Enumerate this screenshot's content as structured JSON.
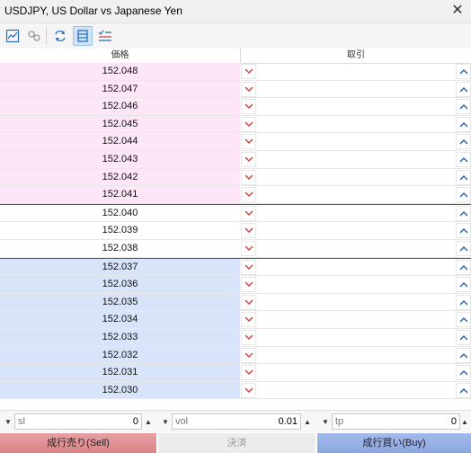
{
  "window": {
    "title": "USDJPY, US Dollar vs Japanese Yen"
  },
  "header": {
    "price_col": "価格",
    "trade_col": "取引"
  },
  "rows": {
    "ask": [
      "152.048",
      "152.047",
      "152.046",
      "152.045",
      "152.044",
      "152.043",
      "152.042",
      "152.041"
    ],
    "mid": [
      "152.040",
      "152.039",
      "152.038"
    ],
    "bid": [
      "152.037",
      "152.036",
      "152.035",
      "152.034",
      "152.033",
      "152.032",
      "152.031",
      "152.030"
    ]
  },
  "inputs": {
    "sl": {
      "placeholder": "sl",
      "value": "0"
    },
    "vol": {
      "placeholder": "vol",
      "value": "0.01"
    },
    "tp": {
      "placeholder": "tp",
      "value": "0"
    }
  },
  "actions": {
    "sell": "成行売り(Sell)",
    "close": "決済",
    "buy": "成行買い(Buy)"
  },
  "colors": {
    "ask_bg": "#fde6f8",
    "bid_bg": "#d7e4fa",
    "sell_btn": "#d98488",
    "buy_btn": "#8ca7e0",
    "chevron_sell": "#d0453f",
    "chevron_buy": "#2b64b8"
  },
  "icons": [
    "chart-icon",
    "link-icon",
    "refresh-icon",
    "depth-icon",
    "list-icon",
    "close-icon",
    "chevron-down-icon",
    "chevron-up-icon"
  ]
}
